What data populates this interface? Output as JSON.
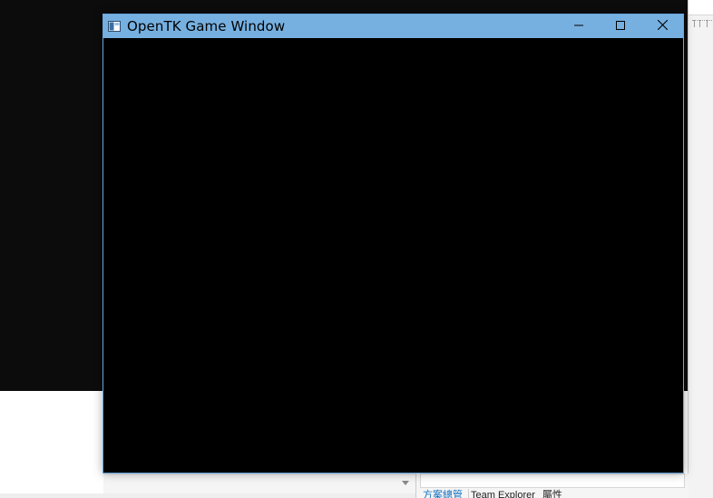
{
  "game_window": {
    "title": "OpenTK Game Window",
    "icon": "app-window-icon",
    "controls": {
      "minimize": "minimize-icon",
      "maximize": "maximize-icon",
      "close": "close-icon"
    },
    "titlebar_color": "#76b0e0",
    "client_color": "#000000"
  },
  "background": {
    "console_color": "#0c0c0c"
  },
  "ide": {
    "bottom_tabs": [
      {
        "label": "方案總管"
      },
      {
        "label": "Team Explorer"
      },
      {
        "label": "屬性"
      }
    ],
    "accent_color": "#0e70c0"
  }
}
